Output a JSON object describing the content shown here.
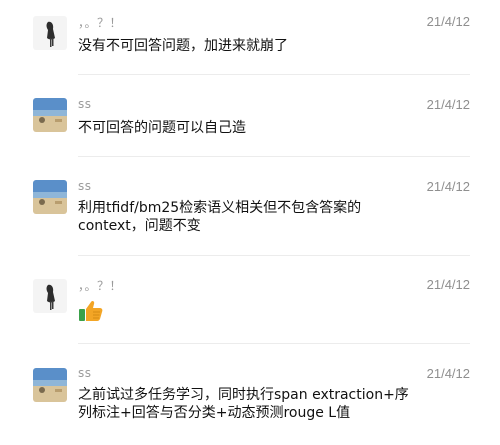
{
  "messages": [
    {
      "sender": "，。？！",
      "time": "21/4/12",
      "text": "没有不可回答问题，加进来就崩了",
      "avatar": "figure"
    },
    {
      "sender": "ss",
      "time": "21/4/12",
      "text": "不可回答的问题可以自己造",
      "avatar": "sea"
    },
    {
      "sender": "ss",
      "time": "21/4/12",
      "line1": "利用tfidf/bm25检索语义相关但不包含答案的",
      "line2": "context，问题不变",
      "avatar": "sea"
    },
    {
      "sender": "，。？！",
      "time": "21/4/12",
      "emoji": "thumbs-up-icon",
      "avatar": "figure"
    },
    {
      "sender": "ss",
      "time": "21/4/12",
      "line1": "之前试过多任务学习，同时执行span extraction+序",
      "line2": "列标注+回答与否分类+动态预测rouge L值",
      "avatar": "sea"
    }
  ],
  "colors": {
    "emoji": "#f3a525",
    "emoji_sleeve": "#3aa14a"
  }
}
